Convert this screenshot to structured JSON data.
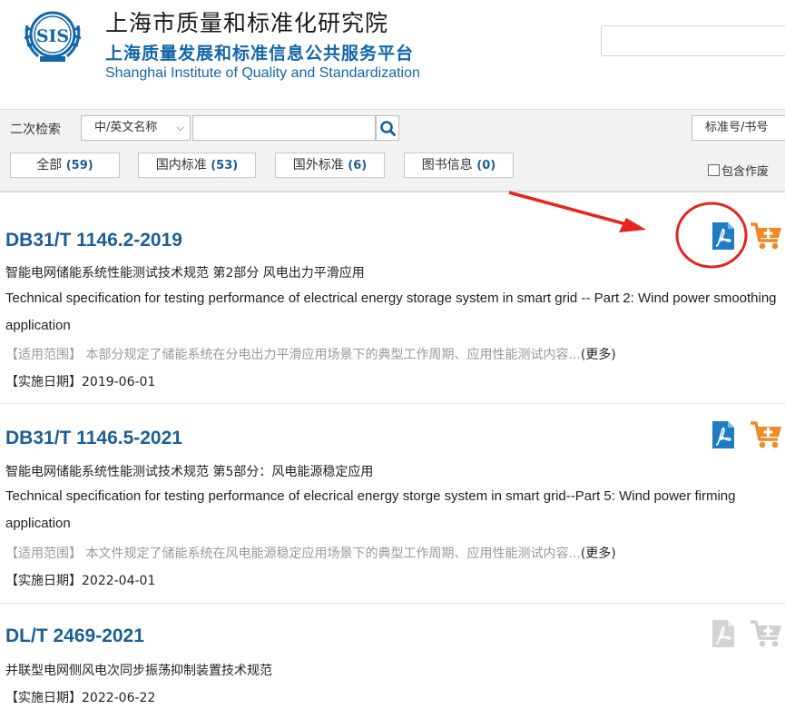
{
  "header": {
    "logo_text": "SIS",
    "title_cn": "上海市质量和标准化研究院",
    "platform_cn": "上海质量发展和标准信息公共服务平台",
    "title_en": "Shanghai Institute of Quality and Standardization"
  },
  "search": {
    "label": "二次检索",
    "field_selected": "中/英文名称",
    "query_value": "",
    "right_button": "标准号/书号"
  },
  "tabs": [
    {
      "label": "全部",
      "count": "(59)"
    },
    {
      "label": "国内标准",
      "count": "(53)"
    },
    {
      "label": "国外标准",
      "count": "(6)"
    },
    {
      "label": "图书信息",
      "count": "(0)"
    }
  ],
  "include_void_label": "包含作废",
  "results": [
    {
      "code": "DB31/T 1146.2-2019",
      "title_cn": "智能电网储能系统性能测试技术规范 第2部分 风电出力平滑应用",
      "title_en": "Technical specification for testing performance of electrical energy storage system in smart grid -- Part 2: Wind power smoothing application",
      "scope_label": "【适用范围】",
      "scope_text": "本部分规定了储能系统在分电出力平滑应用场景下的典型工作周期、应用性能测试内容...",
      "more": "(更多)",
      "date_label": "【实施日期】",
      "date": "2019-06-01",
      "active": true
    },
    {
      "code": "DB31/T 1146.5-2021",
      "title_cn": "智能电网储能系统性能测试技术规范 第5部分：风电能源稳定应用",
      "title_en": "Technical specification for testing performance of elecrical energy storge system in smart grid--Part 5: Wind power firming application",
      "scope_label": "【适用范围】",
      "scope_text": "本文件规定了储能系统在风电能源稳定应用场景下的典型工作周期、应用性能测试内容...",
      "more": "(更多)",
      "date_label": "【实施日期】",
      "date": "2022-04-01",
      "active": true
    },
    {
      "code": "DL/T 2469-2021",
      "title_cn": "并联型电网侧风电次同步振荡抑制装置技术规范",
      "date_label": "【实施日期】",
      "date": "2022-06-22",
      "active": false
    }
  ],
  "icons": {
    "pdf": "pdf-icon",
    "cart": "add-to-cart-icon",
    "search": "search-icon"
  },
  "colors": {
    "link_blue": "#1c5f95",
    "pdf_blue": "#1f7cc2",
    "cart_orange": "#f08a24",
    "disabled_gray": "#cfcfcf",
    "annotation_red": "#e8231f"
  }
}
